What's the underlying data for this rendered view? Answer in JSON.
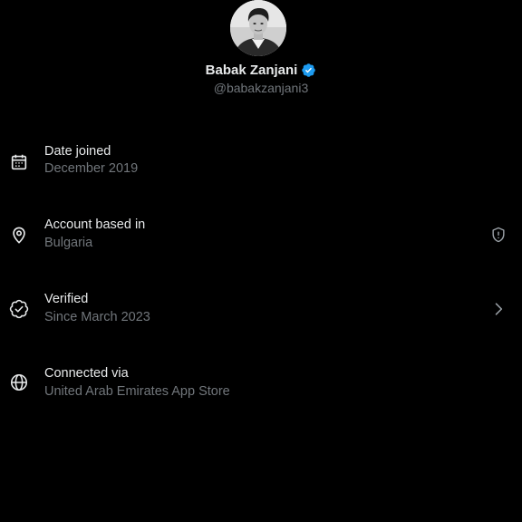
{
  "profile": {
    "display_name": "Babak Zanjani",
    "handle": "@babakzanjani3",
    "verified": true,
    "badge_color": "#1d9bf0"
  },
  "about": [
    {
      "icon": "calendar-icon",
      "title": "Date joined",
      "value": "December 2019"
    },
    {
      "icon": "location-pin-icon",
      "title": "Account based in",
      "value": "Bulgaria",
      "trailing_icon": "shield-alert-icon"
    },
    {
      "icon": "verified-check-icon",
      "title": "Verified",
      "value": "Since March 2023",
      "trailing_icon": "chevron-right-icon"
    },
    {
      "icon": "globe-icon",
      "title": "Connected via",
      "value": "United Arab Emirates App Store"
    }
  ],
  "colors": {
    "background": "#000000",
    "primary_text": "#e7e9ea",
    "secondary_text": "#71767b",
    "accent": "#1d9bf0"
  }
}
